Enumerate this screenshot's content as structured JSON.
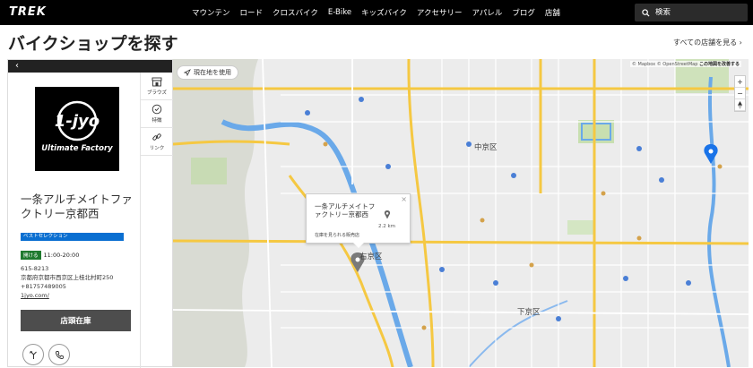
{
  "brand": {
    "logo": "TREK"
  },
  "nav": {
    "items": [
      "マウンテン",
      "ロード",
      "クロスバイク",
      "E-Bike",
      "キッズバイク",
      "アクセサリー",
      "アパレル",
      "ブログ",
      "店舗"
    ]
  },
  "search": {
    "placeholder": "検索",
    "icon": "search-icon"
  },
  "page": {
    "title": "バイクショップを探す",
    "all_stores_link": "すべての店舗を見る ›"
  },
  "panel": {
    "back_label": "‹",
    "tabs": [
      {
        "label": "ブラウズ",
        "icon": "store-icon"
      },
      {
        "label": "特徴",
        "icon": "badge-icon"
      },
      {
        "label": "リンク",
        "icon": "link-icon"
      }
    ],
    "store": {
      "logo_text": "1-jyo",
      "logo_subtext": "Ultimate Factory",
      "name": "一条アルチメイトファクトリー京都西",
      "badge": "ベストセレクション",
      "open_label": "開ける",
      "hours": "11:00-20:00",
      "postal": "615-8213",
      "address": "京都府京都市西京区上桂北村町250",
      "phone": "+81757489005",
      "website": "1jyo.com/"
    },
    "stock_button": "店頭在庫",
    "actions": [
      "directions-icon",
      "phone-icon"
    ]
  },
  "map": {
    "locate_button": "現在地を使用",
    "attribution_prefix": "© Mapbox © OpenStreetMap",
    "attribution_link": "この地図を改善する",
    "zoom_in": "+",
    "zoom_out": "−",
    "labels": {
      "nakagyo": "中京区",
      "ukyo": "右京区",
      "shimogyo": "下京区"
    },
    "popup": {
      "name": "一条アルチメイトファクトリー京都西",
      "distance": "2.2 km",
      "link": "在庫を見られる販売店",
      "close": "×"
    },
    "colors": {
      "road_major": "#f5c842",
      "water": "#6aa9e9",
      "park": "#c8dfb0",
      "pin_selected": "#1a73e8",
      "pin_default": "#7a7a7a"
    }
  }
}
